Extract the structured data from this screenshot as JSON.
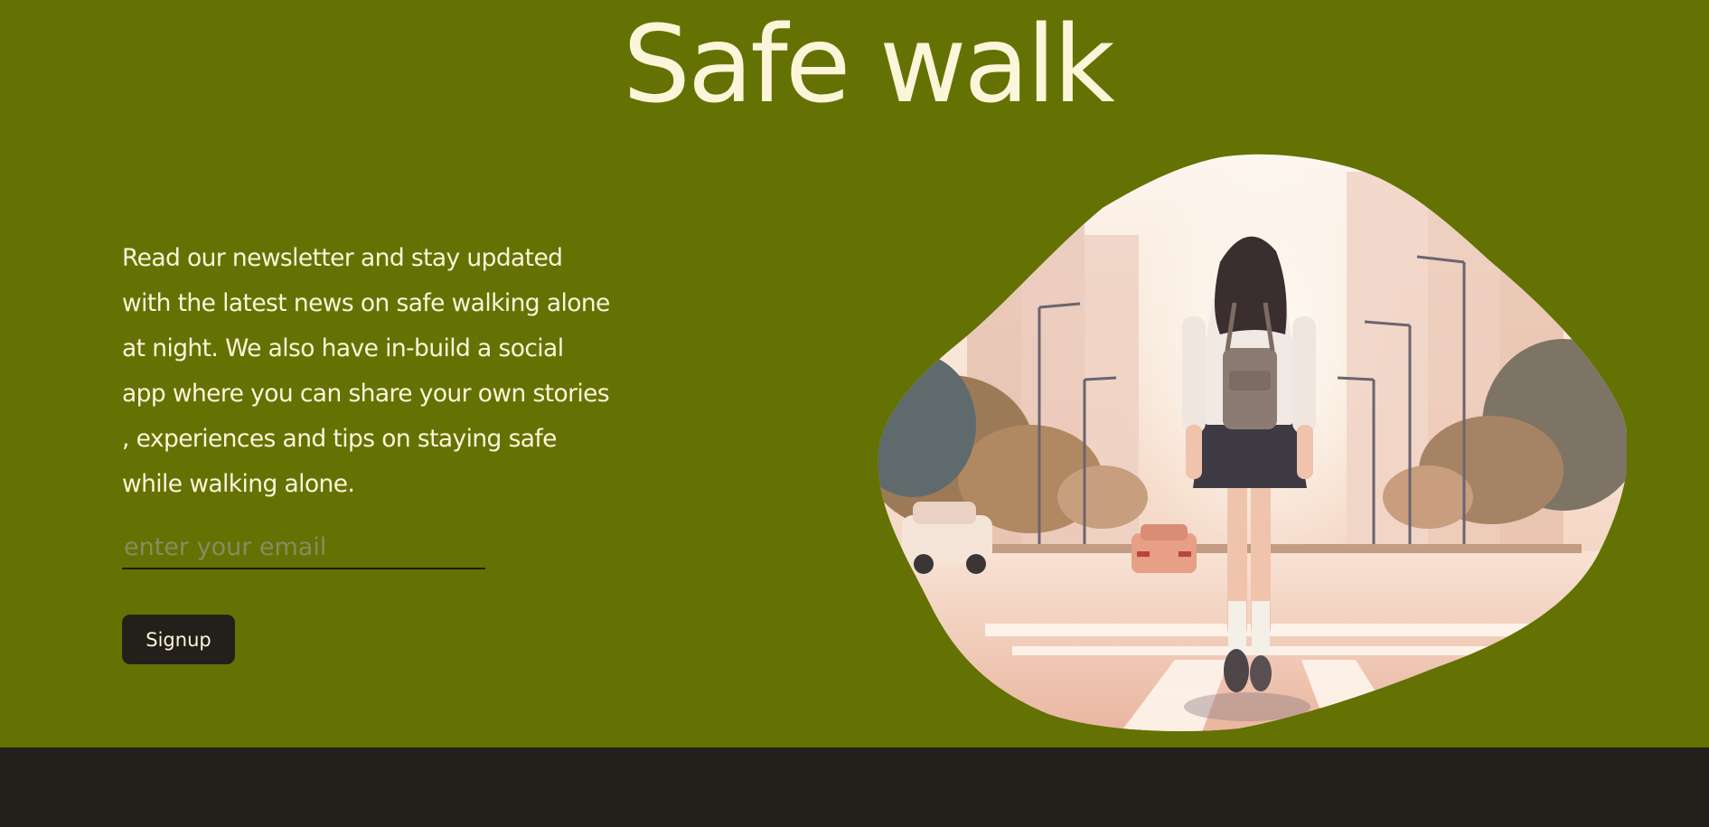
{
  "hero": {
    "title": "Safe walk",
    "blurb": "Read our newsletter and stay updated with the latest news on safe walking alone at night. We also have in-build a social app where you can share your own stories , experiences and tips on staying safe while walking alone.",
    "blurb_lines": [
      "Read our newsletter and stay updated",
      "with the latest news on safe walking alone",
      "at night. We also have in-build a social",
      "app where you can share your own stories",
      ", experiences and tips on staying safe",
      "while walking alone."
    ],
    "email": {
      "value": "",
      "placeholder": "enter your email"
    },
    "signup_label": "Signup"
  },
  "colors": {
    "hero_bg": "#637203",
    "title_text": "#fbf5d9",
    "footer_bg": "#23201b",
    "button_bg": "#23201b"
  }
}
